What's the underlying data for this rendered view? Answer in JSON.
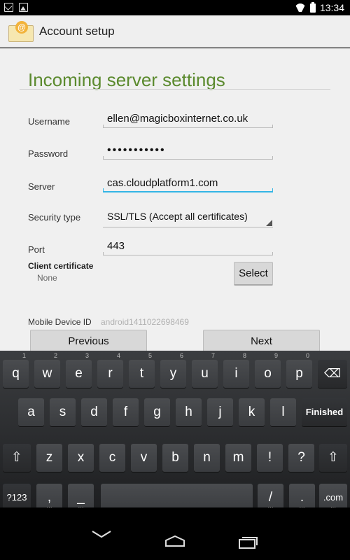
{
  "status": {
    "time": "13:34"
  },
  "actionbar": {
    "title": "Account setup",
    "icon_glyph": "@"
  },
  "form": {
    "heading": "Incoming server settings",
    "username_label": "Username",
    "username_value": "ellen@magicboxinternet.co.uk",
    "password_label": "Password",
    "password_value": "•••••••••••",
    "server_label": "Server",
    "server_value": "cas.cloudplatform1.com",
    "security_label": "Security type",
    "security_value": "SSL/TLS (Accept all certificates)",
    "port_label": "Port",
    "port_value": "443",
    "cert_label": "Client certificate",
    "cert_value": "None",
    "select_label": "Select",
    "device_label": "Mobile Device ID",
    "device_value": "android1411022698469",
    "previous_label": "Previous",
    "next_label": "Next"
  },
  "keyboard": {
    "row1": [
      "q",
      "w",
      "e",
      "r",
      "t",
      "y",
      "u",
      "i",
      "o",
      "p"
    ],
    "row1_hints": [
      "1",
      "2",
      "3",
      "4",
      "5",
      "6",
      "7",
      "8",
      "9",
      "0"
    ],
    "row2": [
      "a",
      "s",
      "d",
      "f",
      "g",
      "h",
      "j",
      "k",
      "l"
    ],
    "row3": [
      "z",
      "x",
      "c",
      "v",
      "b",
      "n",
      "m",
      "!",
      "?"
    ],
    "finished": "Finished",
    "sym": "?123",
    "comma": ",",
    "underscore": "_",
    "slash": "/",
    "period": ".",
    "dotcom": ".com",
    "shift_glyph": "⇧",
    "delete_glyph": "⌫",
    "ellipsis": "···"
  },
  "colors": {
    "accent": "#33b5e5",
    "heading": "#5b8a2e"
  }
}
